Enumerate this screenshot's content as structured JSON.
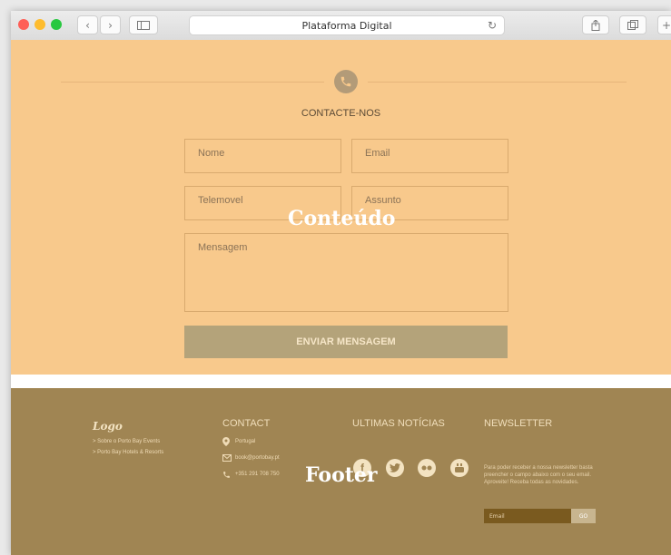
{
  "browser": {
    "title": "Plataforma Digital",
    "colors": {
      "close": "#fe5f57",
      "minimize": "#febc2e",
      "zoom": "#28c840"
    }
  },
  "contact": {
    "title": "CONTACTE-NOS",
    "fields": {
      "name_placeholder": "Nome",
      "email_placeholder": "Email",
      "phone_placeholder": "Telemovel",
      "subject_placeholder": "Assunto",
      "message_placeholder": "Mensagem"
    },
    "submit_label": "ENVIAR MENSAGEM",
    "overlay_label": "Conteúdo"
  },
  "footer": {
    "logo": "Logo",
    "links": [
      "> Sobre o Porto Bay Events",
      "> Porto Bay Hotels & Resorts"
    ],
    "contact_title": "CONTACT",
    "location": "Portugal",
    "email": "book@portobay.pt",
    "phone": "+351 291 708 750",
    "news_title": "ULTIMAS NOTÍCIAS",
    "social_icons": [
      "facebook-icon",
      "twitter-icon",
      "flickr-icon",
      "youtube-icon"
    ],
    "newsletter_title": "NEWSLETTER",
    "newsletter_desc": "Para poder receber a nossa newsletter basta preencher o campo abaixo com o seu email. Aproveite! Receba todas as novidades.",
    "newsletter_placeholder": "Email",
    "newsletter_button": "GO",
    "overlay_label": "Footer"
  }
}
